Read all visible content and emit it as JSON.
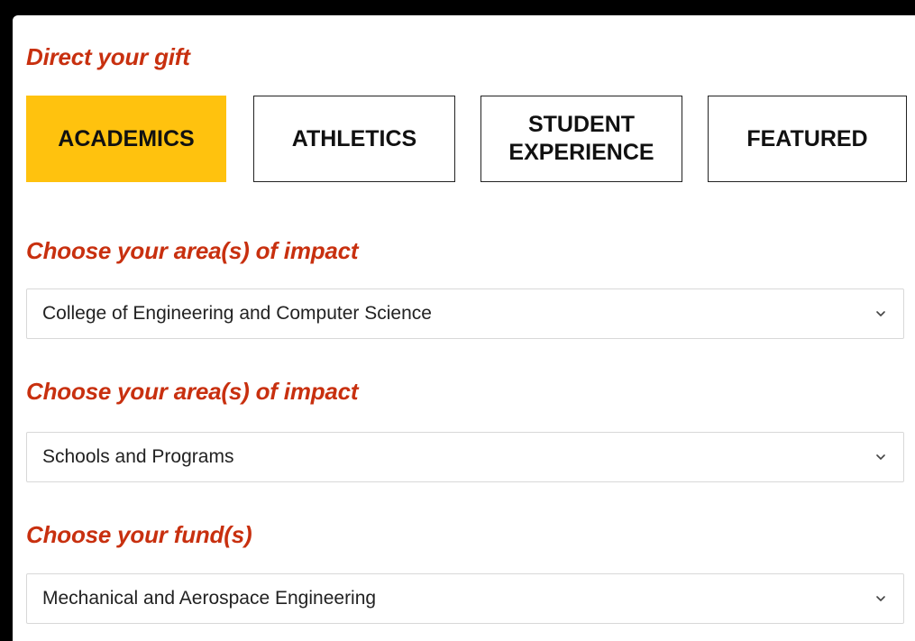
{
  "direct_gift": {
    "heading": "Direct your gift",
    "tabs": [
      {
        "label": "ACADEMICS",
        "active": true
      },
      {
        "label": "ATHLETICS",
        "active": false
      },
      {
        "label": "STUDENT EXPERIENCE",
        "active": false
      },
      {
        "label": "FEATURED",
        "active": false
      }
    ]
  },
  "area_impact_1": {
    "heading": "Choose your area(s) of impact",
    "selected": "College of Engineering and Computer Science"
  },
  "area_impact_2": {
    "heading": "Choose your area(s) of impact",
    "selected": "Schools and Programs"
  },
  "fund": {
    "heading": "Choose your fund(s)",
    "selected": "Mechanical and Aerospace Engineering"
  },
  "icons": {
    "dropdown": "chevron-down-icon"
  },
  "colors": {
    "heading": "#C8300F",
    "active_tab": "#FFC20E",
    "border": "#222222",
    "background": "#000000"
  }
}
